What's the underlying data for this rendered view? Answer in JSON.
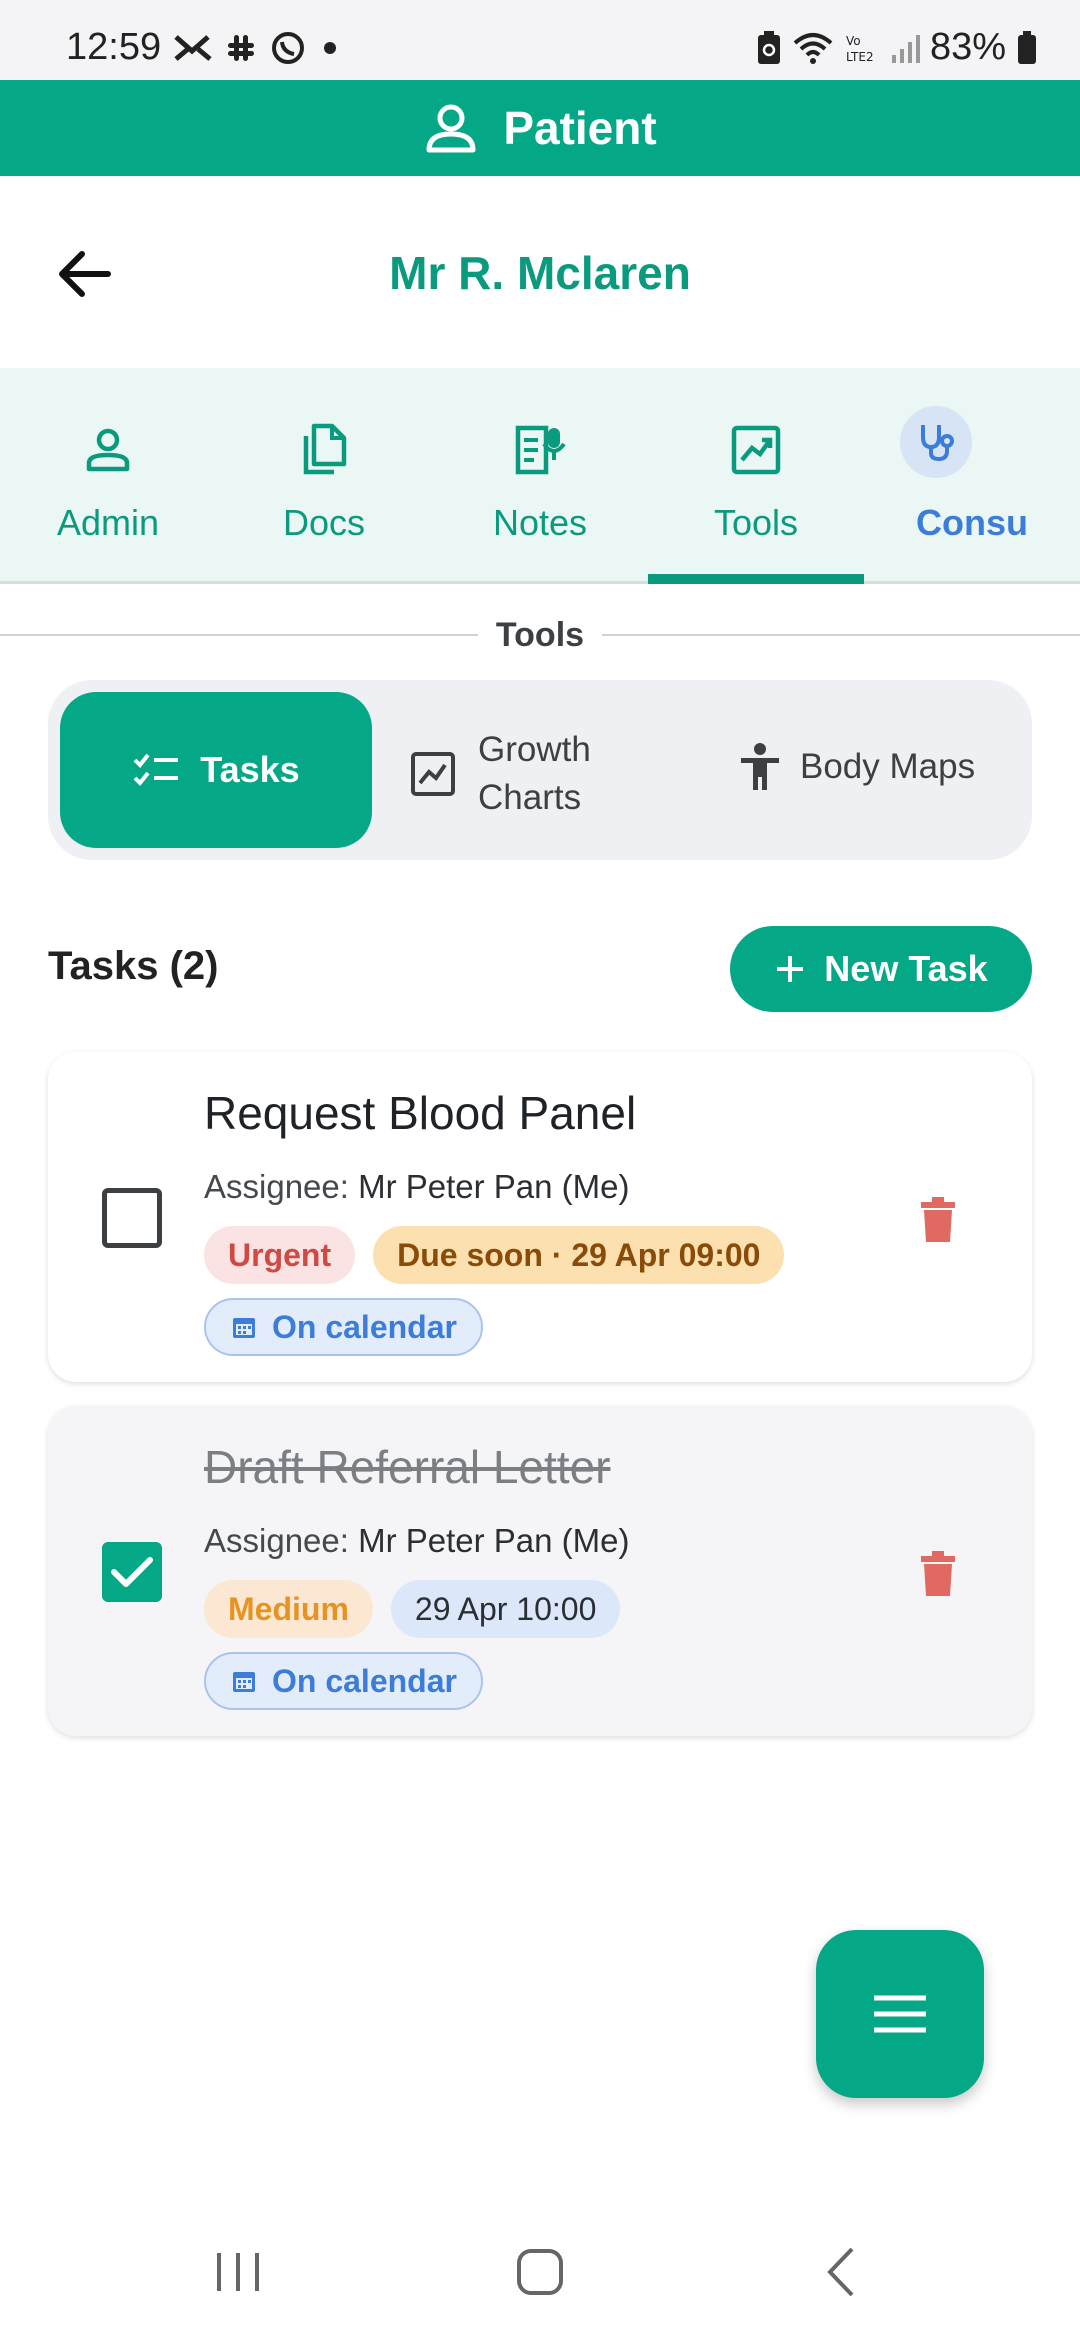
{
  "status_bar": {
    "time": "12:59",
    "battery": "83%",
    "icons": [
      "missed-call-icon",
      "slack-icon",
      "whatsapp-icon",
      "dot-icon",
      "battery-saver-icon",
      "wifi-icon",
      "volte-icon",
      "signal-icon",
      "battery-icon"
    ]
  },
  "header": {
    "title": "Patient",
    "icon": "person-icon"
  },
  "patient": {
    "name": "Mr R. Mclaren"
  },
  "tabs": [
    {
      "label": "Admin",
      "icon": "person-outline-icon"
    },
    {
      "label": "Docs",
      "icon": "documents-icon"
    },
    {
      "label": "Notes",
      "icon": "note-mic-icon"
    },
    {
      "label": "Tools",
      "icon": "chart-line-icon",
      "active": true
    },
    {
      "label": "Consu",
      "icon": "stethoscope-icon"
    }
  ],
  "section": {
    "title": "Tools"
  },
  "segments": [
    {
      "label": "Tasks",
      "selected": true
    },
    {
      "label": "Growth Charts",
      "line1": "Growth",
      "line2": "Charts"
    },
    {
      "label": "Body Maps"
    }
  ],
  "tasks_header": {
    "title": "Tasks (2)",
    "new_button": "New Task"
  },
  "tasks": [
    {
      "title": "Request Blood Panel",
      "assignee_label": "Assignee:",
      "assignee": "Mr Peter Pan (Me)",
      "priority": "Urgent",
      "due": "Due soon · 29 Apr 09:00",
      "calendar": "On calendar",
      "completed": false
    },
    {
      "title": "Draft Referral Letter",
      "assignee_label": "Assignee:",
      "assignee": "Mr Peter Pan (Me)",
      "priority": "Medium",
      "due": "29 Apr 10:00",
      "calendar": "On calendar",
      "completed": true
    }
  ],
  "colors": {
    "primary": "#04a887",
    "primary_text": "#0a9b7f",
    "urgent": "#d04a44",
    "due_soon": "#8a4b09",
    "medium": "#e69323",
    "calendar": "#3b7dd8",
    "delete": "#e06a62"
  }
}
